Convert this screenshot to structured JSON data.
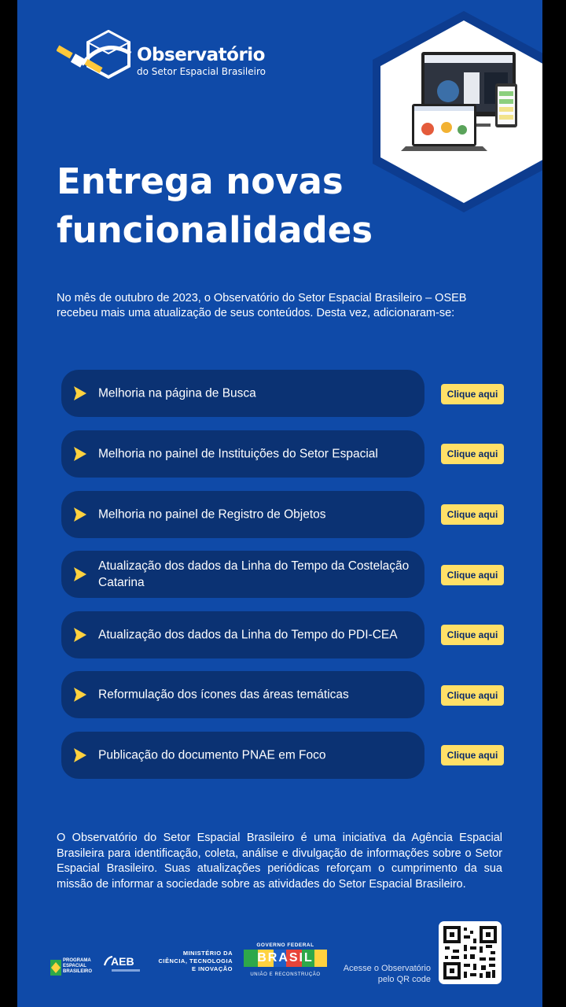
{
  "brand": {
    "title": "Observatório",
    "subtitle": "do Setor Espacial Brasileiro"
  },
  "headline": "Entrega novas funcionalidades",
  "intro": "No mês de outubro de 2023, o Observatório do Setor Espacial Brasileiro – OSEB recebeu mais uma atualização de seus conteúdos. Desta vez, adicionaram-se:",
  "items": [
    {
      "label": "Melhoria na página de Busca",
      "button": "Clique aqui"
    },
    {
      "label": "Melhoria no painel de Instituições do Setor Espacial",
      "button": "Clique aqui"
    },
    {
      "label": "Melhoria no painel de Registro de Objetos",
      "button": "Clique aqui"
    },
    {
      "label": "Atualização dos dados da Linha do Tempo da Costelação  Catarina",
      "button": "Clique aqui"
    },
    {
      "label": "Atualização dos dados da Linha do Tempo do PDI-CEA",
      "button": "Clique aqui"
    },
    {
      "label": "Reformulação dos ícones das áreas temáticas",
      "button": "Clique aqui"
    },
    {
      "label": "Publicação do documento PNAE em Foco",
      "button": "Clique aqui"
    }
  ],
  "about": "O Observatório do Setor Espacial Brasileiro é uma iniciativa da Agência Espacial Brasileira para identificação, coleta, análise e divulgação de informações sobre o Setor Espacial Brasileiro. Suas atualizações periódicas reforçam o cumprimento da sua missão de informar a sociedade sobre as atividades do Setor Espacial Brasileiro.",
  "footer": {
    "peb": [
      "PROGRAMA",
      "ESPACIAL",
      "BRASILEIRO"
    ],
    "aeb": "AEB",
    "ministerio": [
      "MINISTÉRIO DA",
      "CIÊNCIA, TECNOLOGIA",
      "E INOVAÇÃO"
    ],
    "gov_top": "GOVERNO FEDERAL",
    "gov_word": "BRASIL",
    "gov_bottom": "UNIÃO E RECONSTRUÇÃO",
    "qr_caption": "Acesse o Observatório pelo QR code"
  },
  "colors": {
    "background": "#0f4aa8",
    "item_bg": "#0b3273",
    "button": "#ffe067",
    "arrow": "#ffd23f"
  }
}
